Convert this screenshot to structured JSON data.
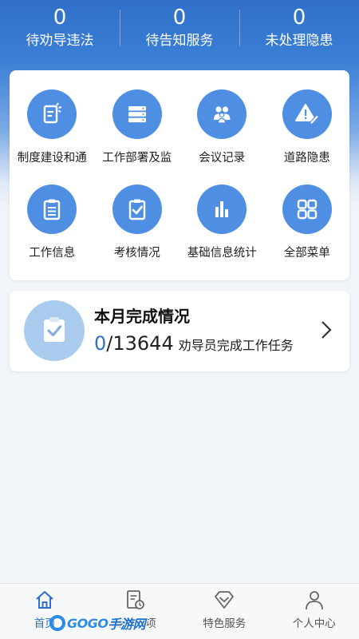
{
  "stats": [
    {
      "value": "0",
      "label": "待劝导违法"
    },
    {
      "value": "0",
      "label": "待告知服务"
    },
    {
      "value": "0",
      "label": "未处理隐患"
    }
  ],
  "menu": [
    {
      "label": "制度建设和通",
      "icon": "document-edit-icon"
    },
    {
      "label": "工作部署及监",
      "icon": "server-list-icon"
    },
    {
      "label": "会议记录",
      "icon": "people-group-icon"
    },
    {
      "label": "道路隐患",
      "icon": "warning-triangle-icon"
    },
    {
      "label": "工作信息",
      "icon": "clipboard-list-icon"
    },
    {
      "label": "考核情况",
      "icon": "clipboard-check-icon"
    },
    {
      "label": "基础信息统计",
      "icon": "bar-chart-icon"
    },
    {
      "label": "全部菜单",
      "icon": "grid-icon"
    }
  ],
  "progress": {
    "title": "本月完成情况",
    "done": "0",
    "total": "/13644",
    "desc": "劝导员完成工作任务",
    "icon": "clipboard-check-icon"
  },
  "tabs": [
    {
      "label": "首页",
      "icon": "home-icon",
      "active": true
    },
    {
      "label": "待办事项",
      "icon": "todo-doc-icon",
      "active": false
    },
    {
      "label": "特色服务",
      "icon": "diamond-icon",
      "active": false
    },
    {
      "label": "个人中心",
      "icon": "person-icon",
      "active": false
    }
  ],
  "watermark": {
    "text": "GOGO",
    "sub": "手游网"
  },
  "colors": {
    "primary": "#2f6fc8",
    "icon_bg": "#4f8fe3",
    "progress_icon_bg": "#a9cbee"
  }
}
